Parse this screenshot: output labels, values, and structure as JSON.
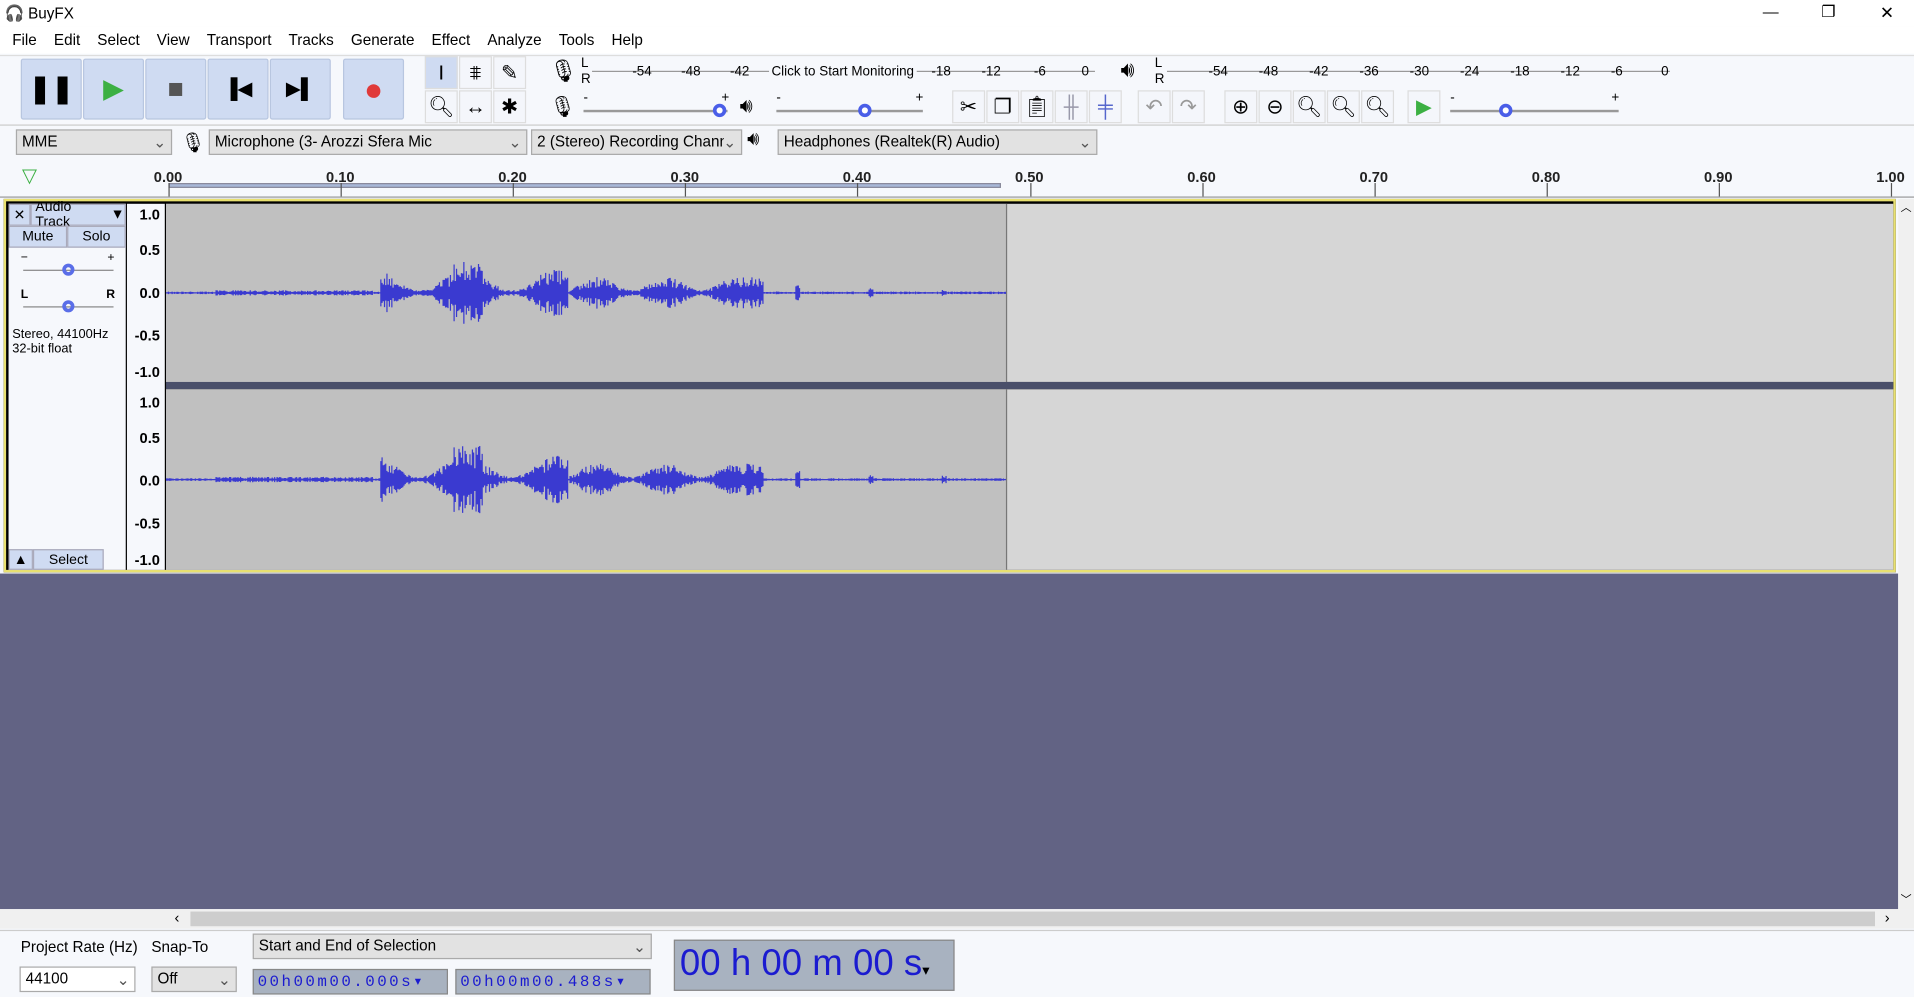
{
  "window": {
    "title": "BuyFX",
    "minimize": "—",
    "restore": "❐",
    "close": "✕"
  },
  "menu": [
    "File",
    "Edit",
    "Select",
    "View",
    "Transport",
    "Tracks",
    "Generate",
    "Effect",
    "Analyze",
    "Tools",
    "Help"
  ],
  "transport": {
    "pause": "pause-icon",
    "play": "play-icon",
    "stop": "stop-icon",
    "skip_start": "skip-start-icon",
    "skip_end": "skip-end-icon",
    "record": "record-icon",
    "play_color": "#3cb043",
    "record_color": "#e03a3a"
  },
  "rec_meter": {
    "ticks": [
      "-54",
      "-48",
      "-42",
      "-18",
      "-12",
      "-6",
      "0"
    ],
    "monitor_label": "Click to Start Monitoring",
    "L": "L",
    "R": "R"
  },
  "play_meter": {
    "ticks": [
      "-54",
      "-48",
      "-42",
      "-36",
      "-30",
      "-24",
      "-18",
      "-12",
      "-6",
      "0"
    ],
    "L": "L",
    "R": "R"
  },
  "sliders": {
    "minus": "-",
    "plus": "+",
    "rec_volume": 1.0,
    "play_volume": 0.6,
    "play_speed": 0.35
  },
  "devices": {
    "host": "MME",
    "recording_device": "Microphone (3- Arozzi Sfera Mic",
    "channels": "2 (Stereo) Recording Chann",
    "playback_device": "Headphones (Realtek(R) Audio)"
  },
  "ruler": {
    "ticks": [
      "0.00",
      "0.10",
      "0.20",
      "0.30",
      "0.40",
      "0.50",
      "0.60",
      "0.70",
      "0.80",
      "0.90",
      "1.00"
    ]
  },
  "track": {
    "name": "Audio Track",
    "mute": "Mute",
    "solo": "Solo",
    "gain_minus": "−",
    "gain_plus": "+",
    "pan_L": "L",
    "pan_R": "R",
    "info1": "Stereo, 44100Hz",
    "info2": "32-bit float",
    "select": "Select",
    "gain": 0.5,
    "pan": 0.5,
    "scale": [
      "1.0",
      "0.5",
      "0.0",
      "-0.5",
      "-1.0"
    ],
    "selection_end": 0.488,
    "clip_end": 0.488,
    "wave_color": "#3a3ad0"
  },
  "bottom": {
    "rate_label": "Project Rate (Hz)",
    "snap_label": "Snap-To",
    "rate": "44100",
    "snap": "Off",
    "selection_mode": "Start and End of Selection",
    "start": "00h00m00.000s",
    "end": "00h00m00.488s",
    "audio_position": "00 h 00 m 00 s"
  },
  "colors": {
    "background": "#626384",
    "selection": "#c0c0c0",
    "unselected": "#d6d6d6",
    "track_border": "#e8e070"
  }
}
